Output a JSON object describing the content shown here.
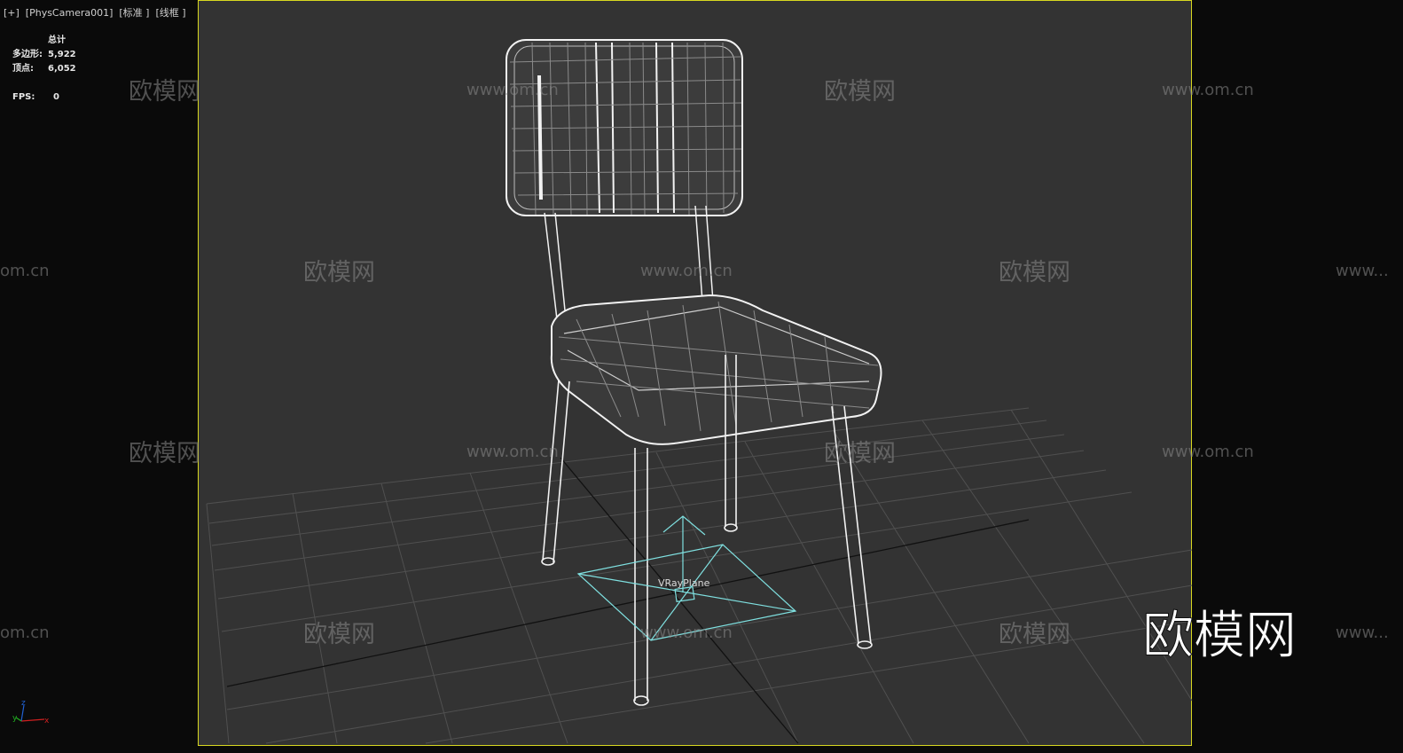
{
  "viewport": {
    "label": "[+]  [PhysCamera001]  [标准 ]  [线框 ]"
  },
  "stats": {
    "header": "总计",
    "polygons_label": "多边形:",
    "polygons_value": "5,922",
    "vertices_label": "顶点:",
    "vertices_value": "6,052",
    "fps_label": "FPS:",
    "fps_value": "0"
  },
  "scene": {
    "object_label": "VRayPlane",
    "wire_color": "#f2f2f2",
    "vrayplane_color": "#7fe0e0",
    "viewport_bg": "#333333",
    "outside_bg": "#0a0a0a",
    "frame_color": "#d8d820"
  },
  "watermark": {
    "brand_cn": "欧模网",
    "site": "www.om.cn",
    "site_clip_right": "om.cn",
    "site_clip_left": "www..."
  },
  "axis_gizmo": {
    "x": "x",
    "y": "y",
    "z": "z"
  }
}
